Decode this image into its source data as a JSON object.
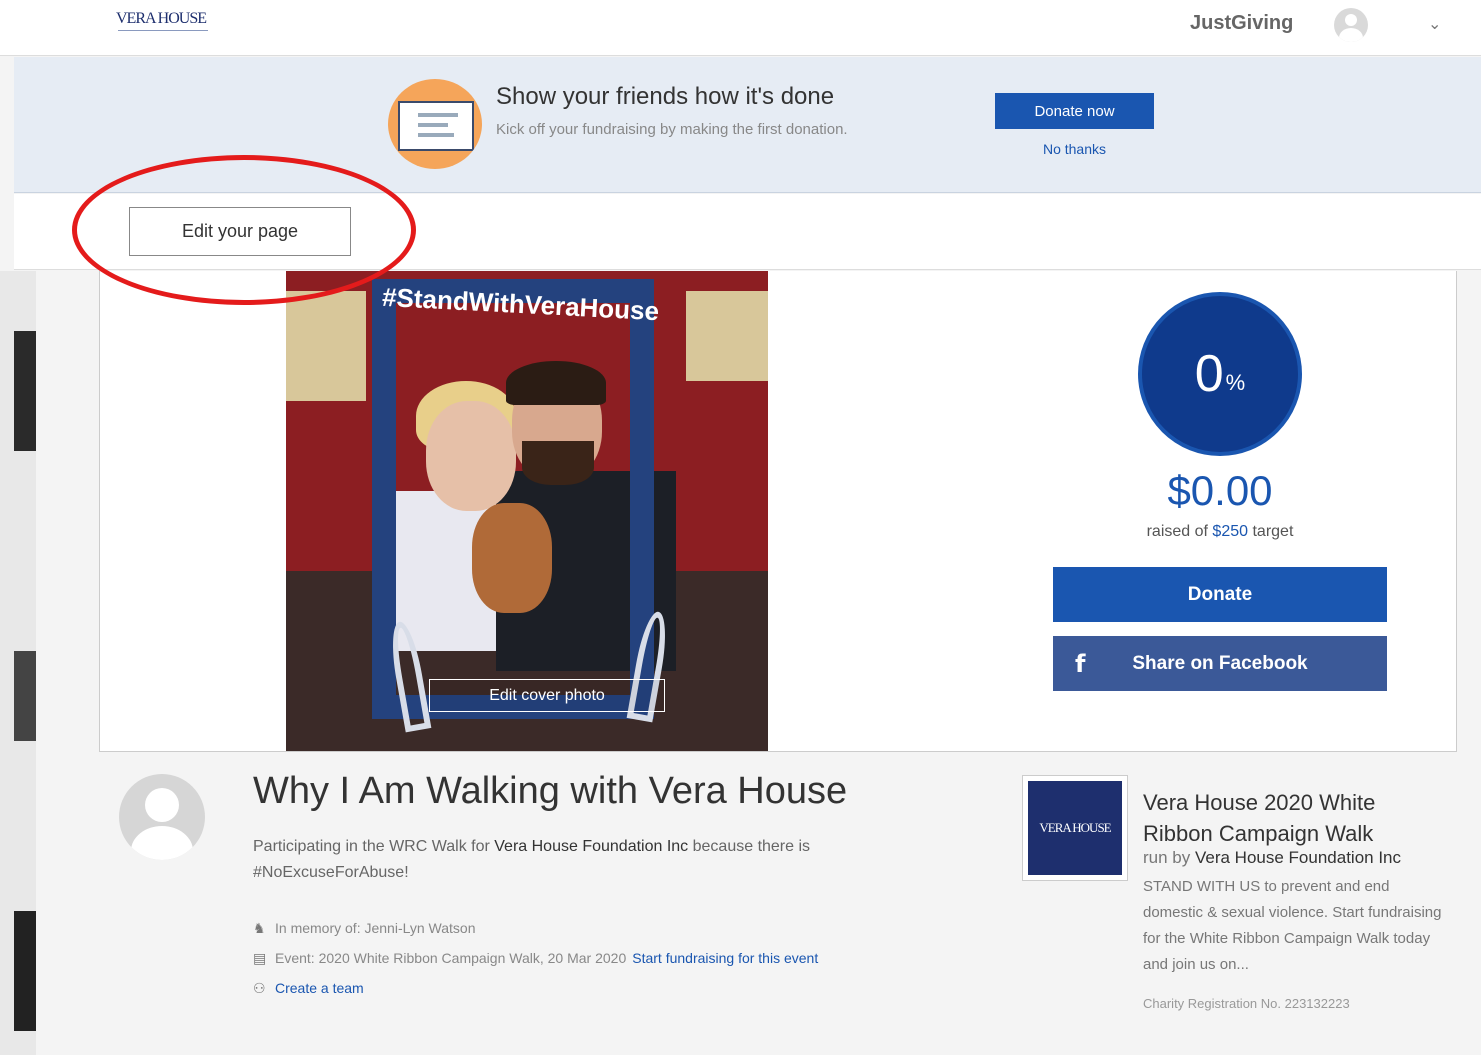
{
  "header": {
    "logo_text": "VERA HOUSE",
    "brand": "JustGiving",
    "account_icon": "user-avatar-icon",
    "menu_icon": "chevron-down-icon"
  },
  "promo": {
    "title": "Show your friends how it's done",
    "subtitle": "Kick off your fundraising by making the first donation.",
    "donate_now_label": "Donate now",
    "no_thanks_label": "No thanks"
  },
  "edit": {
    "edit_page_label": "Edit your page",
    "highlight_color": "#e41b1b"
  },
  "cover": {
    "hashtag": "#StandWithVeraHouse",
    "edit_cover_label": "Edit cover photo"
  },
  "progress": {
    "percent": "0",
    "percent_sign": "%",
    "raised_amount": "$0.00",
    "raised_of_prefix": "raised of",
    "target": "$250",
    "target_suffix": "target",
    "donate_label": "Donate",
    "share_label": "Share on Facebook",
    "share_icon": "facebook-icon",
    "accent_color": "#1a56b0",
    "facebook_color": "#3b5998"
  },
  "fundraiser": {
    "title": "Why I Am Walking with Vera House",
    "desc_prefix": "Participating in the WRC Walk for",
    "desc_org": "Vera House Foundation Inc",
    "desc_suffix": "because there is #NoExcuseForAbuse!",
    "memory": "In memory of: Jenni-Lyn Watson",
    "event": "Event: 2020 White Ribbon Campaign Walk, 20 Mar 2020",
    "start_fundraising_label": "Start fundraising for this event",
    "create_team_label": "Create a team"
  },
  "charity": {
    "logo_text": "VERA HOUSE",
    "name": "Vera House 2020 White Ribbon Campaign Walk",
    "run_by_prefix": "run by",
    "run_by_org": "Vera House Foundation Inc",
    "description": "STAND WITH US to prevent and end domestic & sexual violence. Start fundraising for the White Ribbon Campaign Walk today and join us on...",
    "registration": "Charity Registration No. 223132223"
  }
}
